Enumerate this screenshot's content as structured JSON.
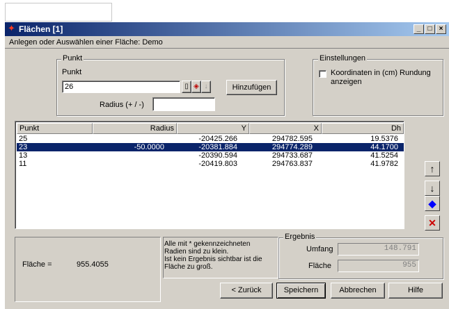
{
  "window": {
    "title": "Flächen [1]",
    "subtitle": "Anlegen oder Auswählen einer Fläche: Demo",
    "controls": {
      "minimize": "_",
      "maximize": "□",
      "close": "×"
    }
  },
  "punkt": {
    "group_label": "Punkt",
    "field_label": "Punkt",
    "value": "26",
    "radius_label": "Radius (+ / -)",
    "radius_value": "",
    "add_button": "Hinzufügen",
    "icons": [
      "list-icon",
      "pick-point-icon",
      "arrow-down-icon"
    ]
  },
  "settings": {
    "group_label": "Einstellungen",
    "checkbox_label": "Koordinaten in (cm) Rundung anzeigen",
    "checked": false
  },
  "table": {
    "columns": [
      "Punkt",
      "Radius",
      "Y",
      "X",
      "Dh"
    ],
    "rows": [
      {
        "punkt": "25",
        "radius": "",
        "y": "-20425.266",
        "x": "294782.595",
        "dh": "19.5376",
        "selected": false
      },
      {
        "punkt": "23",
        "radius": "-50.0000",
        "y": "-20381.884",
        "x": "294774.289",
        "dh": "44.1700",
        "selected": true
      },
      {
        "punkt": "13",
        "radius": "",
        "y": "-20390.594",
        "x": "294733.687",
        "dh": "41.5254",
        "selected": false
      },
      {
        "punkt": "11",
        "radius": "",
        "y": "-20419.803",
        "x": "294763.837",
        "dh": "41.9782",
        "selected": false
      }
    ]
  },
  "side_buttons": {
    "up": "↑",
    "down": "↓",
    "diamond": "◆",
    "delete": "✕",
    "delete_color": "#cc0000",
    "diamond_color": "#0000ff"
  },
  "flaeche_summary": {
    "label": "Fläche =",
    "value": "955.4055"
  },
  "note": {
    "line1": "Alle mit * gekennzeichneten",
    "line2": "Radien sind zu klein.",
    "line3": "Ist kein Ergebnis sichtbar ist die",
    "line4": "Fläche zu groß."
  },
  "ergebnis": {
    "group_label": "Ergebnis",
    "umfang_label": "Umfang",
    "umfang_value": "148.791",
    "flaeche_label": "Fläche",
    "flaeche_value": "955"
  },
  "buttons": {
    "back": "< Zurück",
    "save": "Speichern",
    "cancel": "Abbrechen",
    "help": "Hilfe"
  }
}
